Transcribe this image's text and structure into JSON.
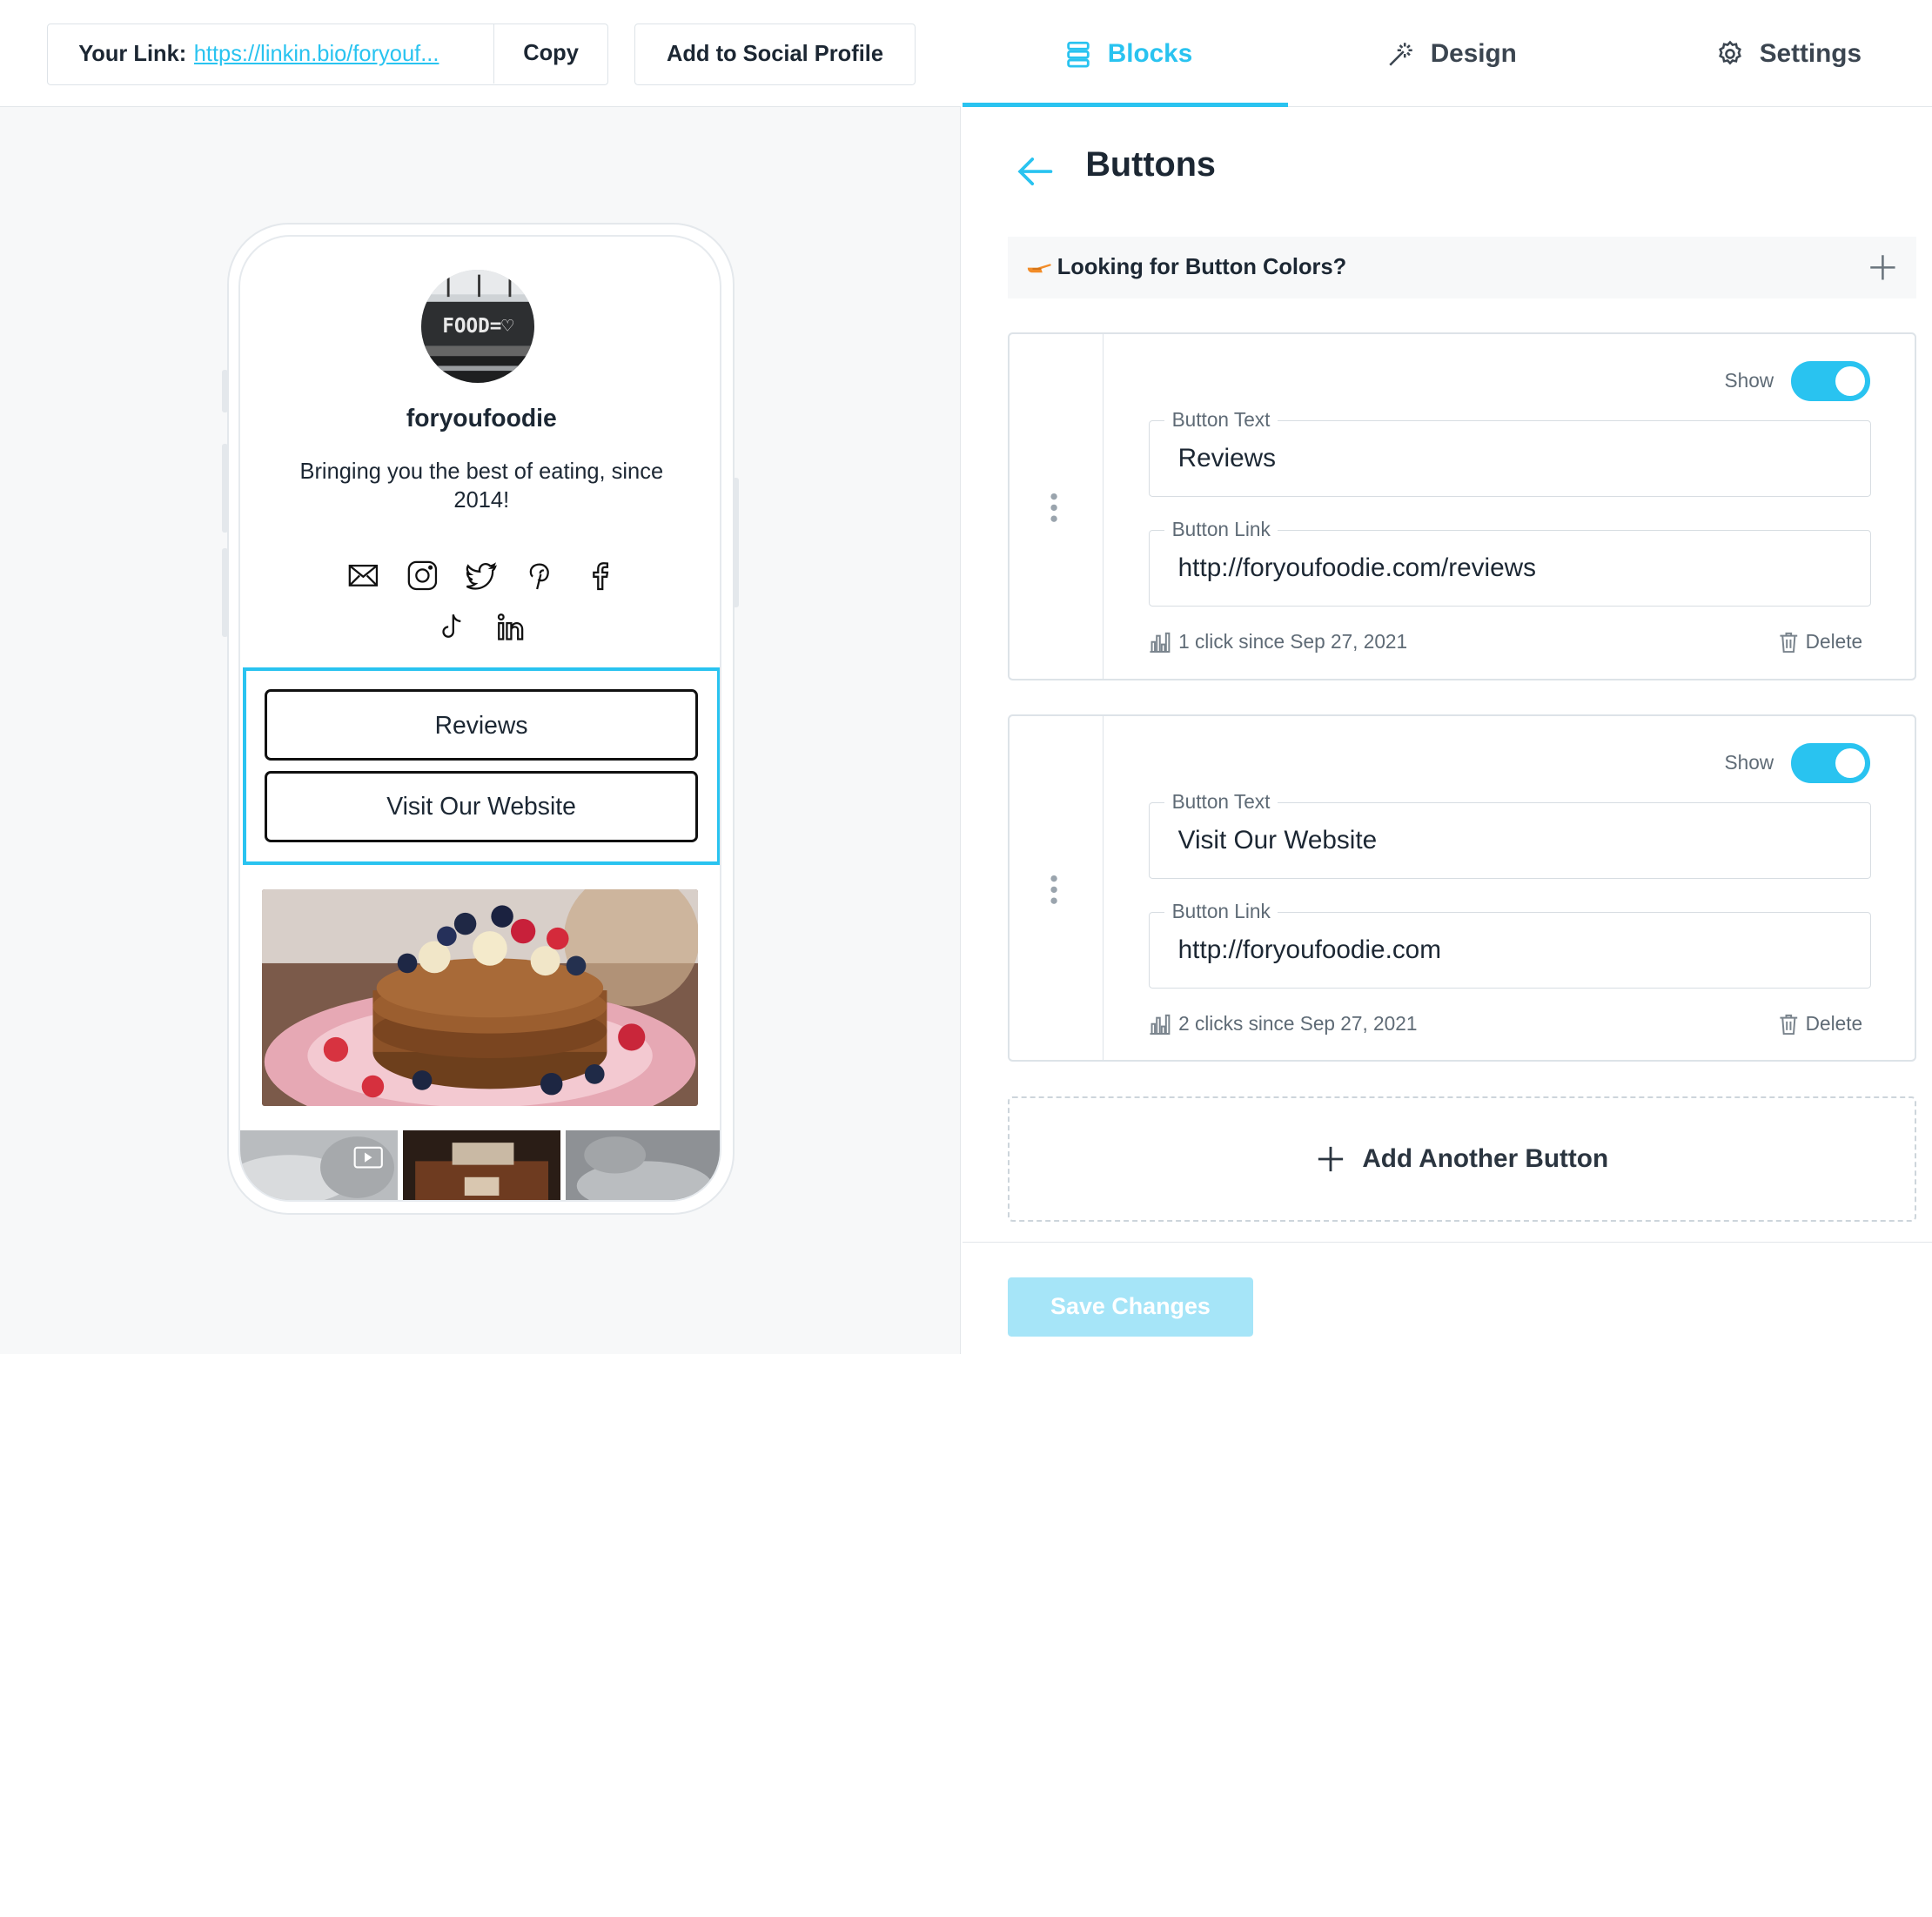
{
  "topbar": {
    "link_label": "Your Link:",
    "link_url": "https://linkin.bio/foryouf...",
    "copy_label": "Copy",
    "social_label": "Add to Social Profile"
  },
  "preview": {
    "avatar_text": "FOOD=♡",
    "name": "foryoufoodie",
    "bio": "Bringing you the best of eating, since 2014!",
    "social_icons": [
      "mail-icon",
      "instagram-icon",
      "twitter-icon",
      "pinterest-icon",
      "facebook-icon",
      "tiktok-icon",
      "linkedin-icon"
    ],
    "buttons": [
      "Reviews",
      "Visit Our Website"
    ]
  },
  "tabs": [
    {
      "label": "Blocks",
      "icon": "blocks-icon",
      "active": true
    },
    {
      "label": "Design",
      "icon": "magic-wand-icon",
      "active": false
    },
    {
      "label": "Settings",
      "icon": "gear-icon",
      "active": false
    }
  ],
  "panel": {
    "title": "Buttons",
    "hint": "Looking for Button Colors?",
    "show_label": "Show",
    "text_label": "Button Text",
    "link_label": "Button Link",
    "delete_label": "Delete",
    "cards": [
      {
        "text": "Reviews",
        "link": "http://foryoufoodie.com/reviews",
        "stats": "1 click since Sep 27, 2021",
        "show": true
      },
      {
        "text": "Visit Our Website",
        "link": "http://foryoufoodie.com",
        "stats": "2 clicks since Sep 27, 2021",
        "show": true
      }
    ],
    "add_label": "Add Another Button",
    "save_label": "Save Changes"
  },
  "colors": {
    "accent": "#29c3f0",
    "save_disabled": "#a6e5f8"
  }
}
